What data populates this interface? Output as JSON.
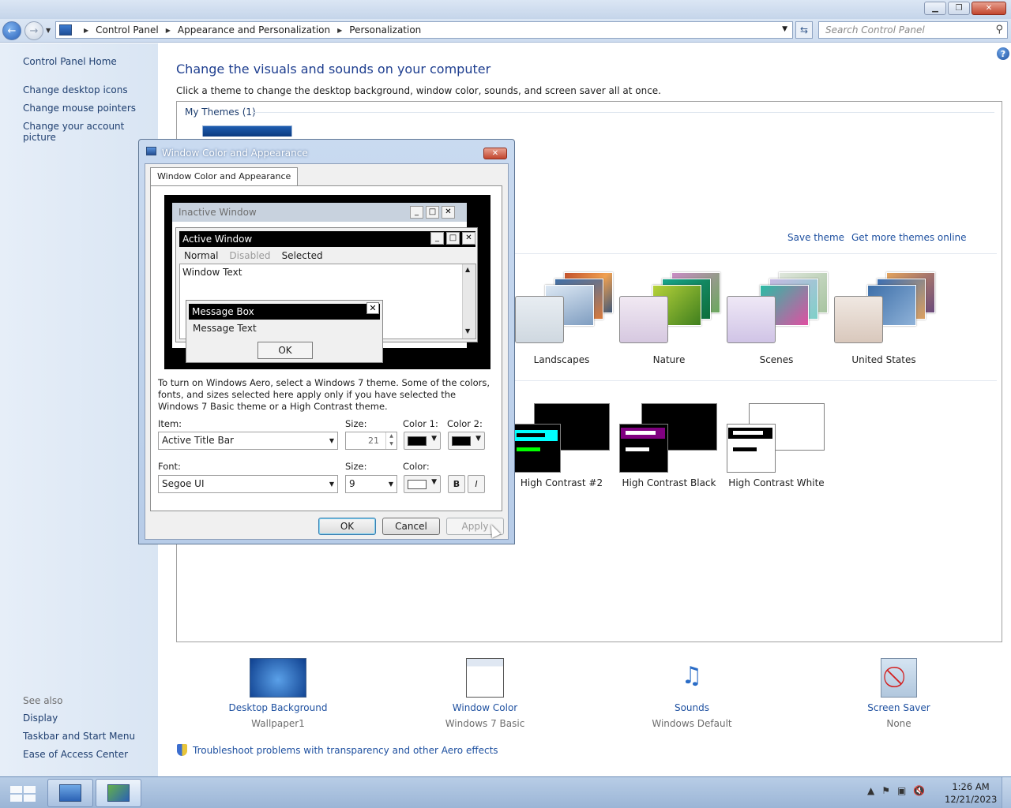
{
  "breadcrumb": [
    "Control Panel",
    "Appearance and Personalization",
    "Personalization"
  ],
  "search": {
    "placeholder": "Search Control Panel"
  },
  "left_pane": {
    "home": "Control Panel Home",
    "links": [
      "Change desktop icons",
      "Change mouse pointers",
      "Change your account picture"
    ],
    "see_also_label": "See also",
    "see_also": [
      "Display",
      "Taskbar and Start Menu",
      "Ease of Access Center"
    ]
  },
  "main": {
    "title": "Change the visuals and sounds on your computer",
    "description": "Click a theme to change the desktop background, window color, sounds, and screen saver all at once.",
    "my_themes": "My Themes (1)",
    "save_theme": "Save theme",
    "get_more": "Get more themes online",
    "aero_themes": [
      "Landscapes",
      "Nature",
      "Scenes",
      "United States"
    ],
    "basic_themes": [
      "High Contrast #2",
      "High Contrast Black",
      "High Contrast White"
    ]
  },
  "bottom": [
    {
      "link": "Desktop Background",
      "sub": "Wallpaper1",
      "icon": "desktop-background-icon"
    },
    {
      "link": "Window Color",
      "sub": "Windows 7 Basic",
      "icon": "window-color-icon"
    },
    {
      "link": "Sounds",
      "sub": "Windows Default",
      "icon": "sounds-icon"
    },
    {
      "link": "Screen Saver",
      "sub": "None",
      "icon": "screen-saver-icon"
    }
  ],
  "troubleshoot": "Troubleshoot problems with transparency and other Aero effects",
  "dialog": {
    "title": "Window Color and Appearance",
    "tab": "Window Color and Appearance",
    "preview": {
      "inactive": "Inactive Window",
      "active": "Active Window",
      "menu_normal": "Normal",
      "menu_disabled": "Disabled",
      "menu_selected": "Selected",
      "window_text": "Window Text",
      "message_box": "Message Box",
      "message_text": "Message Text",
      "ok": "OK"
    },
    "info": "To turn on Windows Aero, select a Windows 7 theme.  Some of the colors, fonts, and sizes selected here apply only if you have selected the Windows 7 Basic theme or a High Contrast theme.",
    "item_label": "Item:",
    "item_value": "Active Title Bar",
    "size_label": "Size:",
    "size_value": "21",
    "color1_label": "Color 1:",
    "color2_label": "Color 2:",
    "font_label": "Font:",
    "font_value": "Segoe UI",
    "font_size_label": "Size:",
    "font_size_value": "9",
    "color_label": "Color:",
    "bold": "B",
    "italic": "I",
    "ok": "OK",
    "cancel": "Cancel",
    "apply": "Apply",
    "color1": "#000000",
    "color2": "#000000",
    "font_color": "#ffffff"
  },
  "clock": {
    "time": "1:26 AM",
    "date": "12/21/2023"
  },
  "colors": {
    "link": "#1e50a0",
    "heading": "#1e3e8f",
    "hc2_accent": "#00ffff",
    "hc_black_accent": "#800080",
    "hc2_green": "#00ff00"
  }
}
